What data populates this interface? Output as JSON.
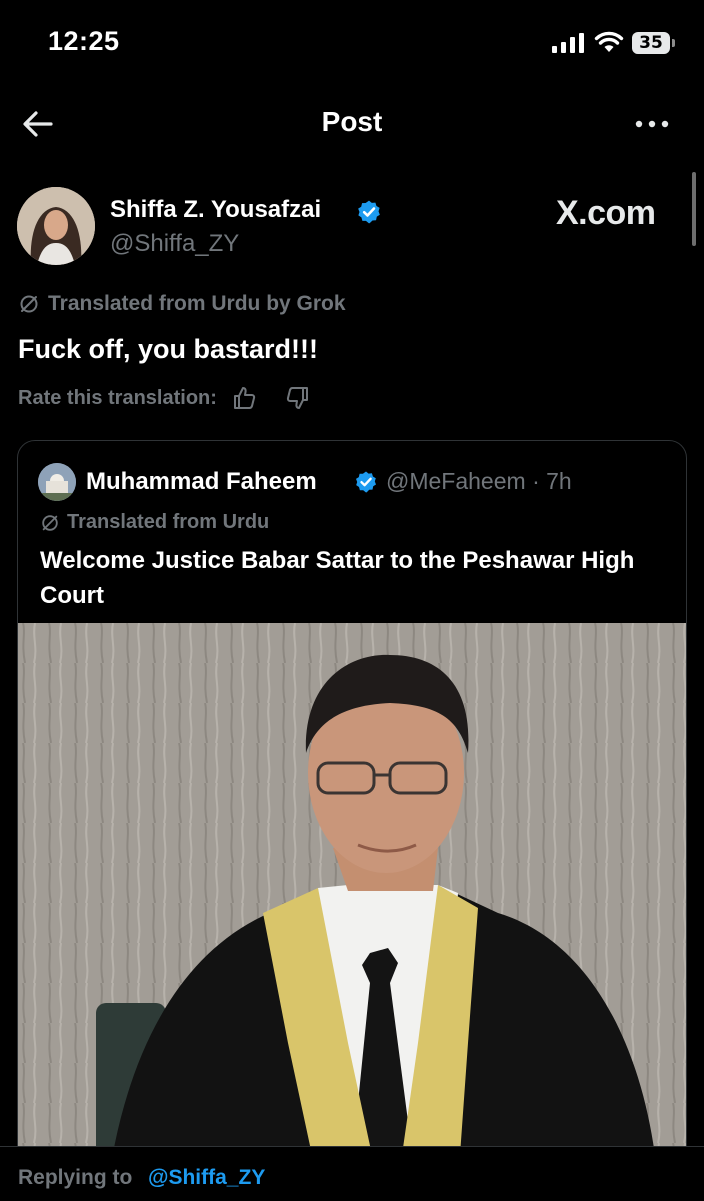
{
  "status_bar": {
    "time": "12:25",
    "battery": "35"
  },
  "header": {
    "title": "Post"
  },
  "post": {
    "author_name": "Shiffa Z. Yousafzai",
    "author_handle": "@Shiffa_ZY",
    "watermark": "X.com",
    "translation_label": "Translated from Urdu by Grok",
    "text": "Fuck off, you bastard!!!",
    "rate_label": "Rate this translation:"
  },
  "quoted_post": {
    "author_name": "Muhammad Faheem",
    "meta": "@MeFaheem · 7h",
    "translation_label": "Translated from Urdu",
    "text": "Welcome Justice Babar Sattar to the Peshawar High Court"
  },
  "reply": {
    "label": "Replying to",
    "handle": "@Shiffa_ZY"
  },
  "colors": {
    "accent": "#1d9bf0",
    "muted": "#71767b",
    "background": "#000000",
    "gold_trim": "#d9c56a"
  },
  "icons": [
    "back-arrow-icon",
    "more-icon",
    "verified-badge-icon",
    "translate-icon",
    "thumbs-up-icon",
    "thumbs-down-icon",
    "signal-icon",
    "wifi-icon",
    "battery-icon"
  ]
}
